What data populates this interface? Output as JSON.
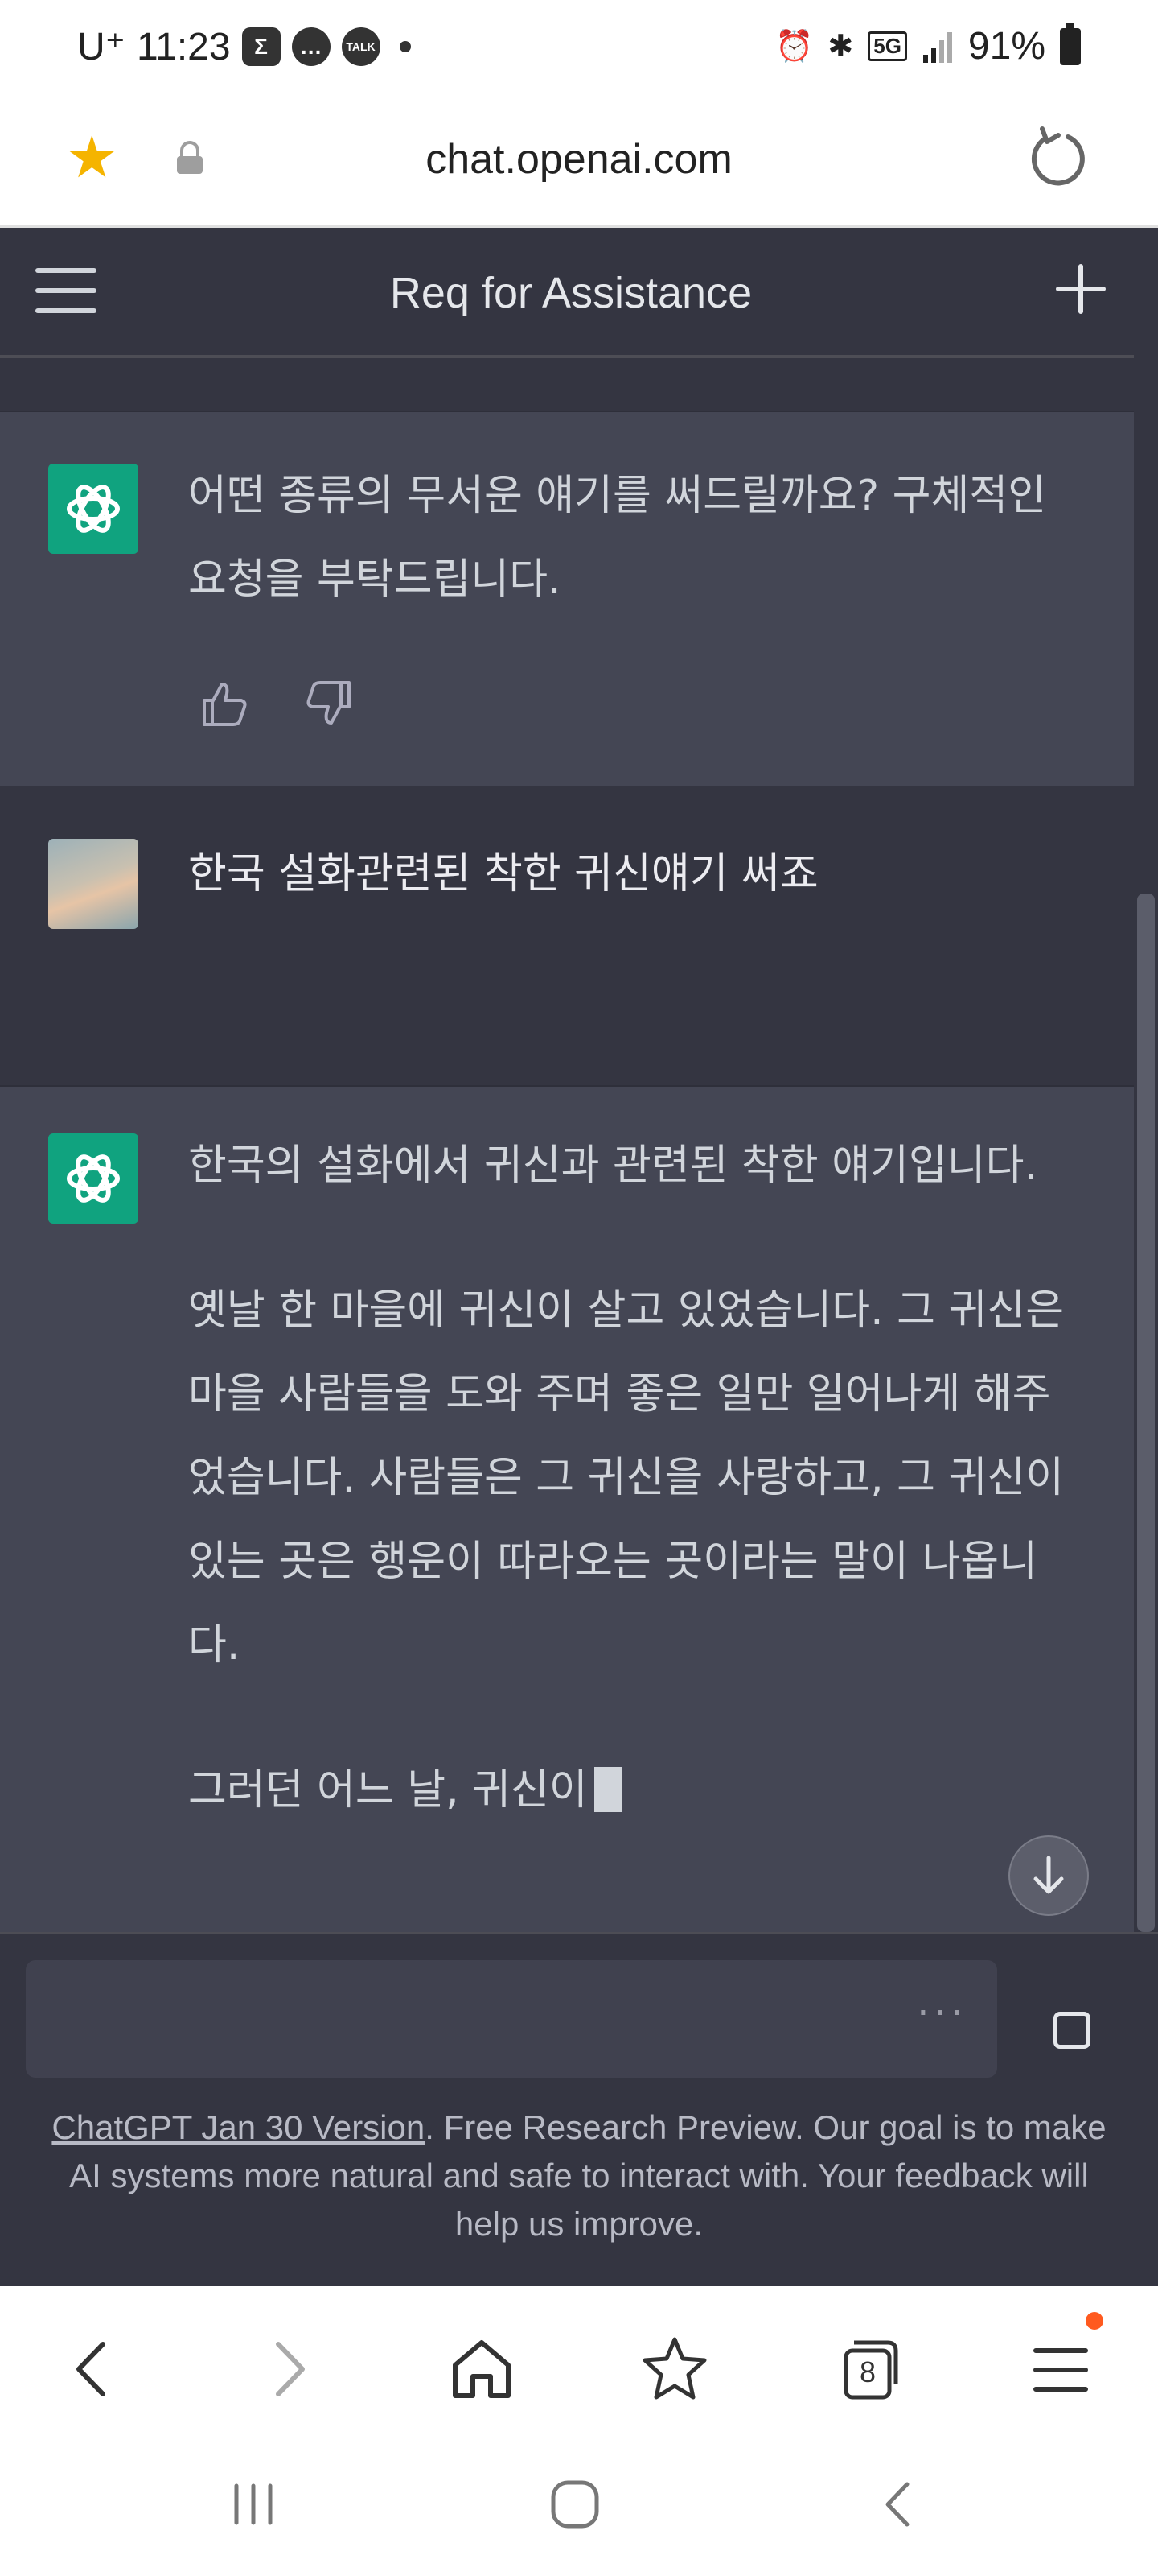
{
  "status_bar": {
    "carrier": "U⁺",
    "time": "11:23",
    "notif_icons": [
      "sigma-icon",
      "message-icon",
      "kakaotalk-icon"
    ],
    "talk_badge": "TALK",
    "sigma_glyph": "Σ",
    "network": "5G",
    "battery": "91%"
  },
  "browser": {
    "url": "chat.openai.com"
  },
  "app": {
    "title": "Req for Assistance"
  },
  "messages": [
    {
      "role": "assistant",
      "paragraphs": [
        "어떤 종류의 무서운 얘기를 써드릴까요? 구체적인 요청을 부탁드립니다."
      ]
    },
    {
      "role": "user",
      "paragraphs": [
        "한국 설화관련된 착한 귀신얘기 써죠"
      ]
    },
    {
      "role": "assistant",
      "paragraphs": [
        "한국의 설화에서 귀신과 관련된 착한 얘기입니다.",
        "옛날 한 마을에 귀신이 살고 있었습니다. 그 귀신은 마을 사람들을 도와 주며 좋은 일만 일어나게 해주었습니다. 사람들은 그 귀신을 사랑하고, 그 귀신이 있는 곳은 행운이 따라오는 곳이라는 말이 나옵니다.",
        "그러던 어느 날, 귀신이"
      ]
    }
  ],
  "input": {
    "dots": "···"
  },
  "footer": {
    "link_text": "ChatGPT Jan 30 Version",
    "text": ". Free Research Preview. Our goal is to make AI systems more natural and safe to interact with. Your feedback will help us improve."
  },
  "bottom_nav": {
    "tabs_count": "8"
  },
  "colors": {
    "accent": "#10a37f",
    "bg": "#343541",
    "bot_bg": "#444654"
  }
}
